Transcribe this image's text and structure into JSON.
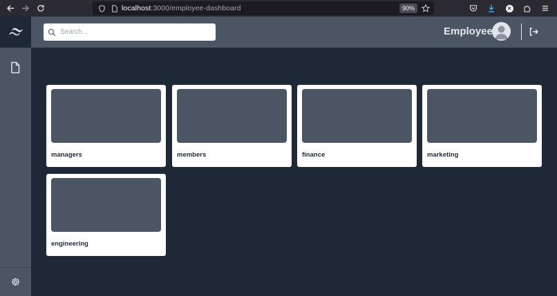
{
  "browser": {
    "url_host": "localhost",
    "url_path": ":3000/employee-dashboard",
    "zoom": "90%"
  },
  "header": {
    "search_placeholder": "Search...",
    "user_name": "Employee"
  },
  "sidebar": {
    "items": [
      {
        "icon": "document-icon"
      },
      {
        "icon": "gear-icon"
      }
    ]
  },
  "cards": [
    {
      "label": "managers"
    },
    {
      "label": "members"
    },
    {
      "label": "finance"
    },
    {
      "label": "marketing"
    },
    {
      "label": "engineering"
    }
  ],
  "colors": {
    "background": "#1f2836",
    "header": "#4b5563",
    "card": "#ffffff",
    "thumbnail": "#4b5563"
  }
}
